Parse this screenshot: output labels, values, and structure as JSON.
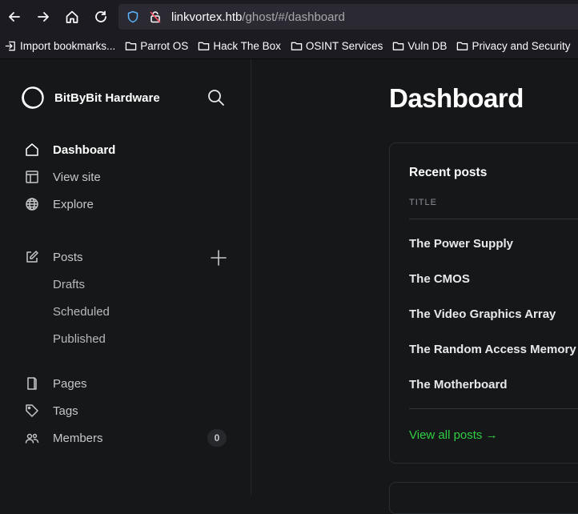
{
  "browser": {
    "url_host": "linkvortex.htb",
    "url_path": "/ghost/#/dashboard",
    "bookmarks": [
      {
        "label": "Import bookmarks...",
        "icon": "import-icon"
      },
      {
        "label": "Parrot OS",
        "icon": "folder-icon"
      },
      {
        "label": "Hack The Box",
        "icon": "folder-icon"
      },
      {
        "label": "OSINT Services",
        "icon": "folder-icon"
      },
      {
        "label": "Vuln DB",
        "icon": "folder-icon"
      },
      {
        "label": "Privacy and Security",
        "icon": "folder-icon"
      }
    ]
  },
  "sidebar": {
    "brand": "BitByBit Hardware",
    "items": [
      {
        "label": "Dashboard",
        "icon": "home-icon"
      },
      {
        "label": "View site",
        "icon": "layout-icon"
      },
      {
        "label": "Explore",
        "icon": "globe-icon"
      },
      {
        "label": "Posts",
        "icon": "edit-icon"
      },
      {
        "label": "Pages",
        "icon": "page-icon"
      },
      {
        "label": "Tags",
        "icon": "tag-icon"
      },
      {
        "label": "Members",
        "icon": "members-icon"
      }
    ],
    "sub_items": [
      "Drafts",
      "Scheduled",
      "Published"
    ],
    "members_count": "0"
  },
  "main": {
    "title": "Dashboard",
    "recent_posts": {
      "title": "Recent posts",
      "column": "TITLE",
      "posts": [
        "The Power Supply",
        "The CMOS",
        "The Video Graphics Array",
        "The Random Access Memory",
        "The Motherboard"
      ],
      "view_all": "View all posts →"
    }
  },
  "colors": {
    "accent": "#30cf43",
    "background": "#151719",
    "sidebar_border": "#26282b"
  }
}
